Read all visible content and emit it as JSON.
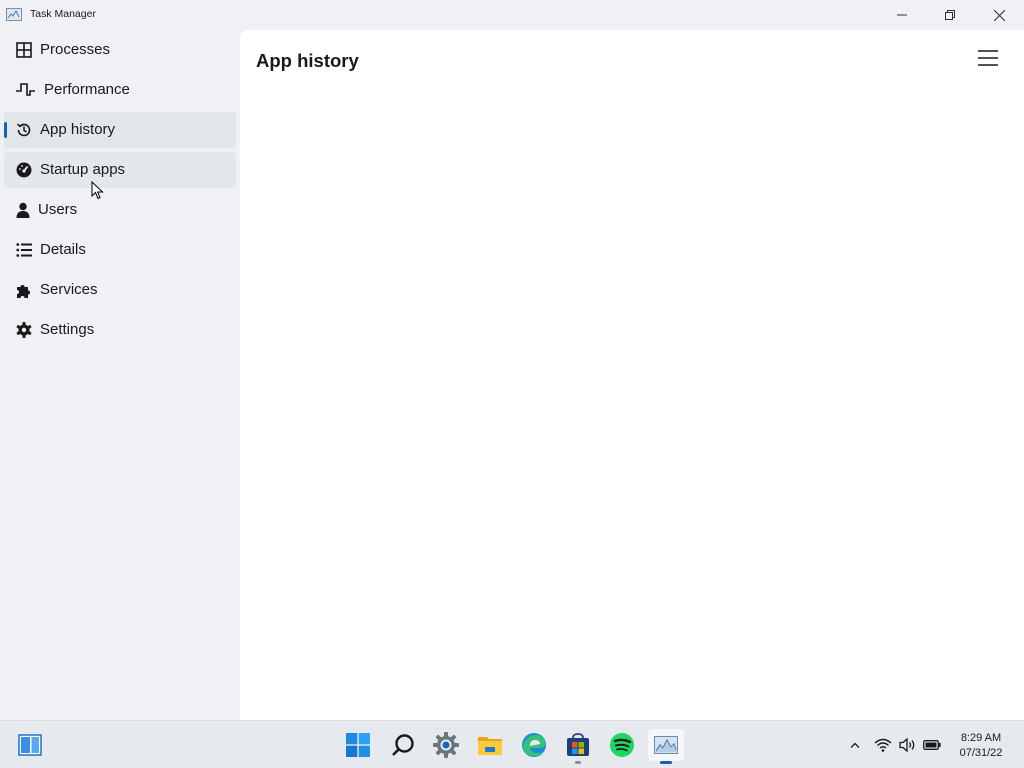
{
  "window": {
    "title": "Task Manager",
    "icon": "task-manager-icon",
    "controls": [
      "minimize-icon",
      "restore-icon",
      "close-icon"
    ]
  },
  "sidebar": {
    "items": [
      {
        "label": "Processes",
        "icon": "grid-icon"
      },
      {
        "label": "Performance",
        "icon": "pulse-icon"
      },
      {
        "label": "App history",
        "icon": "history-icon",
        "selected": true
      },
      {
        "label": "Startup apps",
        "icon": "gauge-icon",
        "hovered": true
      },
      {
        "label": "Users",
        "icon": "user-icon"
      },
      {
        "label": "Details",
        "icon": "list-icon"
      },
      {
        "label": "Services",
        "icon": "puzzle-icon"
      },
      {
        "label": "Settings",
        "icon": "gear-icon"
      }
    ]
  },
  "main": {
    "title": "App history",
    "menu_icon": "hamburger-menu-icon"
  },
  "taskbar": {
    "apps": [
      {
        "name": "widgets-icon"
      },
      {
        "name": "start-icon"
      },
      {
        "name": "search-icon"
      },
      {
        "name": "settings-app-icon"
      },
      {
        "name": "file-explorer-icon"
      },
      {
        "name": "edge-icon"
      },
      {
        "name": "store-icon"
      },
      {
        "name": "spotify-icon"
      },
      {
        "name": "task-manager-app-icon",
        "active": true
      }
    ],
    "tray": [
      "chevron-up-icon",
      "wifi-icon",
      "volume-icon",
      "battery-icon"
    ],
    "clock": {
      "time": "8:29 AM",
      "date": "07/31/22"
    }
  },
  "colors": {
    "accent": "#1565c0",
    "sidebar_bg": "#eff1f5",
    "content_bg": "#ffffff",
    "taskbar_bg": "#e6eaee"
  }
}
